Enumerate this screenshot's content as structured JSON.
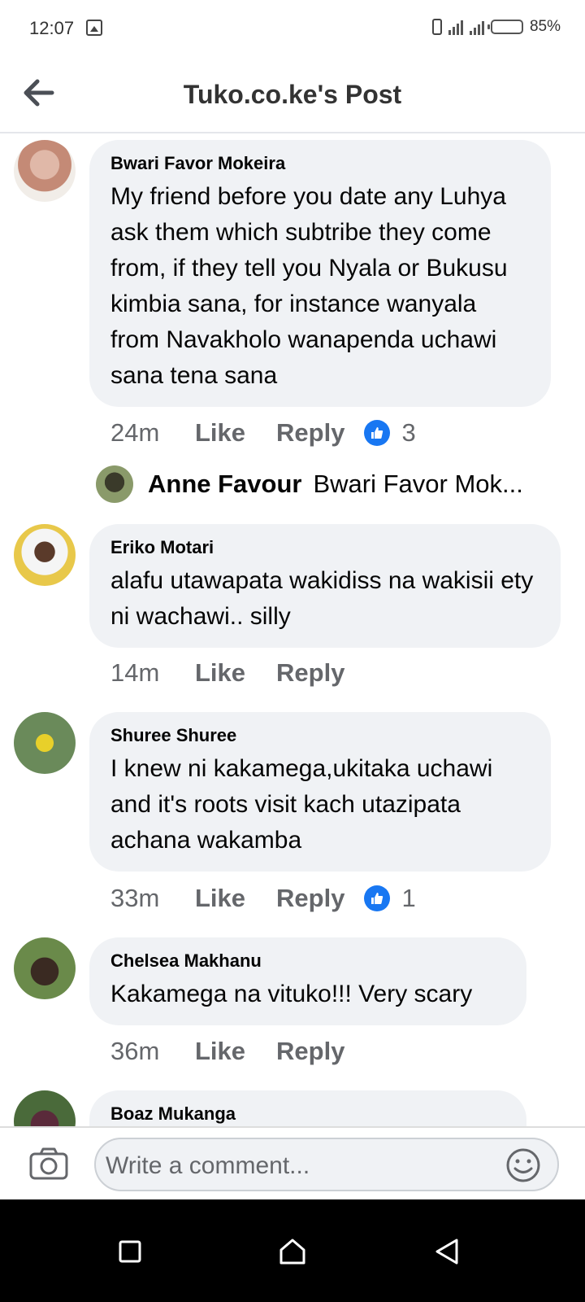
{
  "status_bar": {
    "time": "12:07",
    "battery": "85%",
    "battery_level": 0.85
  },
  "header": {
    "title": "Tuko.co.ke's Post"
  },
  "comments": [
    {
      "name": "Bwari Favor Mokeira",
      "text": "My friend before you date any Luhya ask them which subtribe they come from, if they tell you Nyala or Bukusu kimbia sana, for instance wanyala from Navakholo wanapenda uchawi sana tena sana",
      "time": "24m",
      "like": "Like",
      "reply": "Reply",
      "reactions": "3"
    },
    {
      "name": "Eriko Motari",
      "text": "alafu utawapata wakidiss na wakisii ety ni wachawi.. silly",
      "time": "14m",
      "like": "Like",
      "reply": "Reply"
    },
    {
      "name": "Shuree Shuree",
      "text": "I knew ni kakamega,ukitaka uchawi and it's roots visit kach utazipata achana wakamba",
      "time": "33m",
      "like": "Like",
      "reply": "Reply",
      "reactions": "1"
    },
    {
      "name": "Chelsea Makhanu",
      "text": "Kakamega na vituko!!! Very scary",
      "time": "36m",
      "like": "Like",
      "reply": "Reply"
    },
    {
      "name": "Boaz Mukanga"
    }
  ],
  "reply_preview": {
    "name": "Anne Favour",
    "text": "Bwari Favor Mok..."
  },
  "composer": {
    "placeholder": "Write a comment..."
  },
  "colors": {
    "bubble": "#f0f2f5",
    "like_blue": "#1877f2",
    "meta_gray": "#65676b"
  }
}
